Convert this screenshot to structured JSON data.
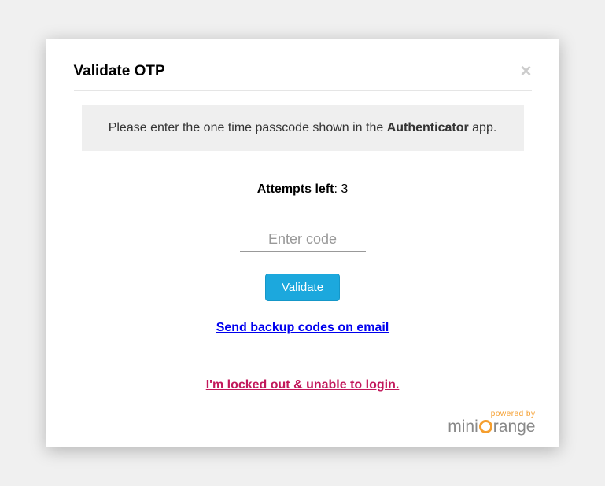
{
  "header": {
    "title": "Validate OTP"
  },
  "instruction": {
    "prefix": "Please enter the one time passcode shown in the ",
    "bold": "Authenticator",
    "suffix": " app."
  },
  "attempts": {
    "label": "Attempts left",
    "value": "3"
  },
  "input": {
    "placeholder": "Enter code",
    "value": ""
  },
  "buttons": {
    "validate": "Validate"
  },
  "links": {
    "backup": "Send backup codes on email",
    "locked": "I'm locked out & unable to login."
  },
  "footer": {
    "powered_by": "powered by",
    "brand_part1": "mini",
    "brand_part2": "range"
  }
}
